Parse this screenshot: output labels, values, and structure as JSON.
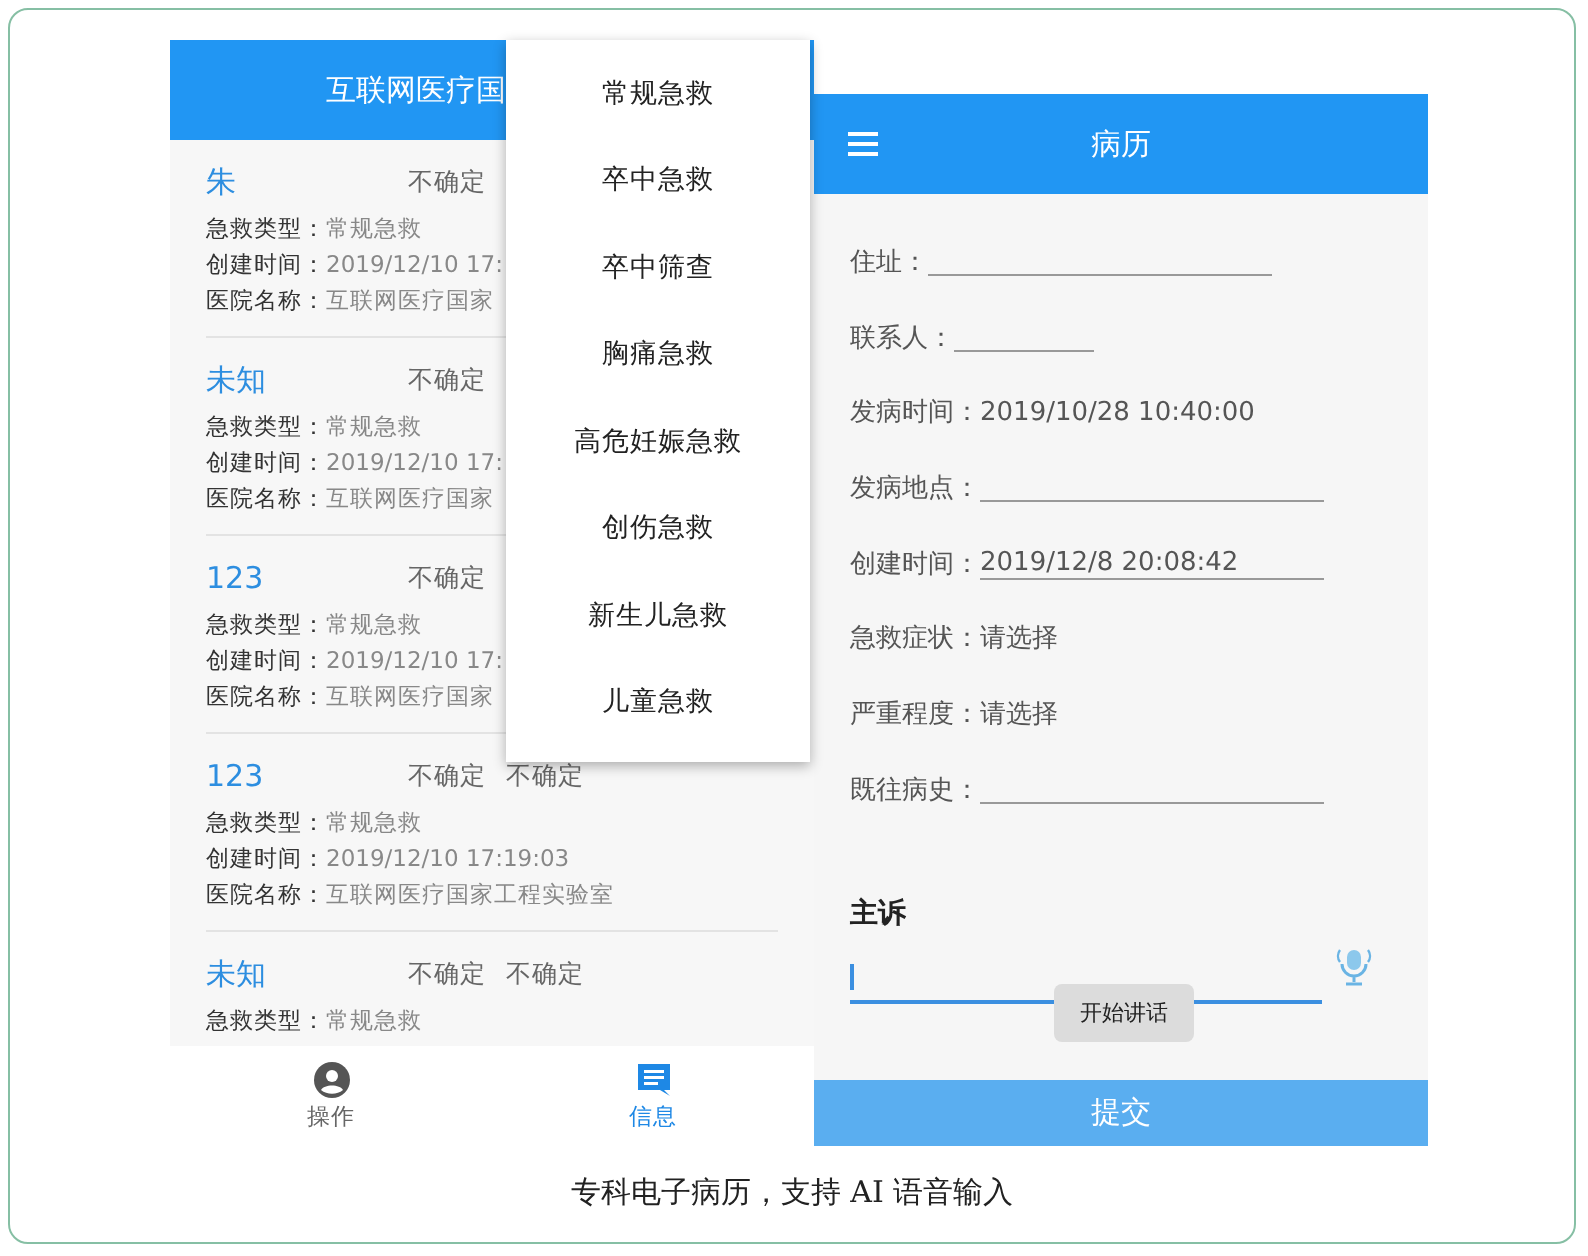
{
  "left_screen": {
    "title": "互联网医疗国",
    "records": [
      {
        "name": "朱",
        "statuses": [
          "不确定"
        ],
        "fields": [
          {
            "label": "急救类型：",
            "value": "常规急救"
          },
          {
            "label": "创建时间：",
            "value": "2019/12/10 17:"
          },
          {
            "label": "医院名称：",
            "value": "互联网医疗国家"
          }
        ]
      },
      {
        "name": "未知",
        "statuses": [
          "不确定"
        ],
        "fields": [
          {
            "label": "急救类型：",
            "value": "常规急救"
          },
          {
            "label": "创建时间：",
            "value": "2019/12/10 17:"
          },
          {
            "label": "医院名称：",
            "value": "互联网医疗国家"
          }
        ]
      },
      {
        "name": "123",
        "statuses": [
          "不确定"
        ],
        "fields": [
          {
            "label": "急救类型：",
            "value": "常规急救"
          },
          {
            "label": "创建时间：",
            "value": "2019/12/10 17:"
          },
          {
            "label": "医院名称：",
            "value": "互联网医疗国家"
          }
        ]
      },
      {
        "name": "123",
        "statuses": [
          "不确定",
          "不确定"
        ],
        "fields": [
          {
            "label": "急救类型：",
            "value": "常规急救"
          },
          {
            "label": "创建时间：",
            "value": "2019/12/10 17:19:03"
          },
          {
            "label": "医院名称：",
            "value": "互联网医疗国家工程实验室"
          }
        ]
      },
      {
        "name": "未知",
        "statuses": [
          "不确定",
          "不确定"
        ],
        "fields": [
          {
            "label": "急救类型：",
            "value": "常规急救"
          }
        ]
      }
    ],
    "tabs": [
      {
        "label": "操作",
        "kind": "person",
        "selected": false
      },
      {
        "label": "信息",
        "kind": "message",
        "selected": true
      }
    ]
  },
  "dropdown_menu": {
    "items": [
      "常规急救",
      "卒中急救",
      "卒中筛查",
      "胸痛急救",
      "高危妊娠急救",
      "创伤急救",
      "新生儿急救",
      "儿童急救"
    ]
  },
  "right_screen": {
    "title": "病历",
    "fields": [
      {
        "label": "住址：",
        "kind": "blank"
      },
      {
        "label": "联系人：",
        "kind": "short_blank"
      },
      {
        "label": "发病时间：",
        "kind": "text",
        "value": "2019/10/28 10:40:00"
      },
      {
        "label": "发病地点：",
        "kind": "blank"
      },
      {
        "label": "创建时间：",
        "kind": "underlined",
        "value": "2019/12/8 20:08:42"
      },
      {
        "label": "急救症状：",
        "kind": "text",
        "value": "请选择"
      },
      {
        "label": "严重程度：",
        "kind": "text",
        "value": "请选择"
      },
      {
        "label": "既往病史：",
        "kind": "blank"
      }
    ],
    "complaint": {
      "label": "主诉",
      "toast": "开始讲话"
    },
    "submit": "提交"
  },
  "caption": "专科电子病历，支持 AI 语音输入"
}
